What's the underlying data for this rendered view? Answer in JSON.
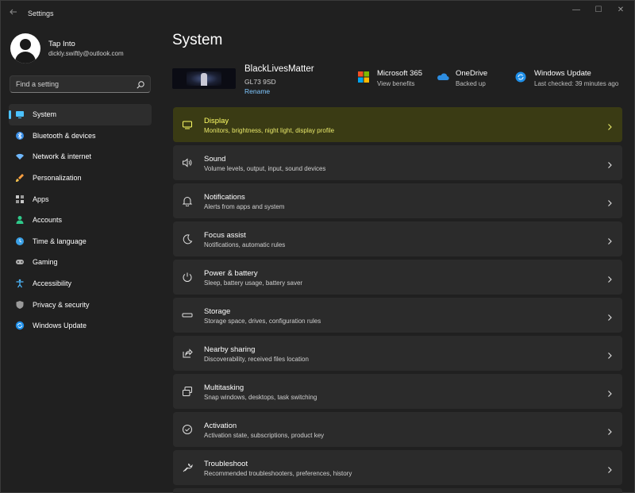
{
  "app": {
    "title": "Settings"
  },
  "window_controls": {
    "minimize": "—",
    "maximize": "☐",
    "close": "✕"
  },
  "user": {
    "name": "Tap Into",
    "email": "dickly.swiftly@outlook.com"
  },
  "search": {
    "placeholder": "Find a setting"
  },
  "sidebar": {
    "items": [
      {
        "label": "System",
        "icon": "monitor-icon",
        "active": true
      },
      {
        "label": "Bluetooth & devices",
        "icon": "bluetooth-icon"
      },
      {
        "label": "Network & internet",
        "icon": "wifi-icon"
      },
      {
        "label": "Personalization",
        "icon": "brush-icon"
      },
      {
        "label": "Apps",
        "icon": "apps-icon"
      },
      {
        "label": "Accounts",
        "icon": "person-icon"
      },
      {
        "label": "Time & language",
        "icon": "globe-clock-icon"
      },
      {
        "label": "Gaming",
        "icon": "gamepad-icon"
      },
      {
        "label": "Accessibility",
        "icon": "accessibility-icon"
      },
      {
        "label": "Privacy & security",
        "icon": "shield-icon"
      },
      {
        "label": "Windows Update",
        "icon": "update-icon"
      }
    ]
  },
  "main": {
    "title": "System",
    "device": {
      "name": "BlackLivesMatter",
      "model": "GL73 9SD",
      "rename": "Rename"
    },
    "quick_links": [
      {
        "title": "Microsoft 365",
        "sub": "View benefits",
        "icon": "microsoft-logo-icon"
      },
      {
        "title": "OneDrive",
        "sub": "Backed up",
        "icon": "onedrive-icon"
      },
      {
        "title": "Windows Update",
        "sub": "Last checked: 39 minutes ago",
        "icon": "update-icon"
      }
    ],
    "cards": [
      {
        "title": "Display",
        "desc": "Monitors, brightness, night light, display profile",
        "icon": "display-icon",
        "highlight": true
      },
      {
        "title": "Sound",
        "desc": "Volume levels, output, input, sound devices",
        "icon": "speaker-icon"
      },
      {
        "title": "Notifications",
        "desc": "Alerts from apps and system",
        "icon": "bell-icon"
      },
      {
        "title": "Focus assist",
        "desc": "Notifications, automatic rules",
        "icon": "moon-icon"
      },
      {
        "title": "Power & battery",
        "desc": "Sleep, battery usage, battery saver",
        "icon": "power-icon"
      },
      {
        "title": "Storage",
        "desc": "Storage space, drives, configuration rules",
        "icon": "storage-icon"
      },
      {
        "title": "Nearby sharing",
        "desc": "Discoverability, received files location",
        "icon": "share-icon"
      },
      {
        "title": "Multitasking",
        "desc": "Snap windows, desktops, task switching",
        "icon": "multitask-icon"
      },
      {
        "title": "Activation",
        "desc": "Activation state, subscriptions, product key",
        "icon": "check-circle-icon"
      },
      {
        "title": "Troubleshoot",
        "desc": "Recommended troubleshooters, preferences, history",
        "icon": "wrench-icon"
      }
    ]
  },
  "colors": {
    "accent": "#4cc2ff",
    "highlight_bg": "#3a3b14",
    "highlight_text": "#ffff66",
    "card_bg": "#2b2b2b",
    "window_bg": "#202020"
  }
}
